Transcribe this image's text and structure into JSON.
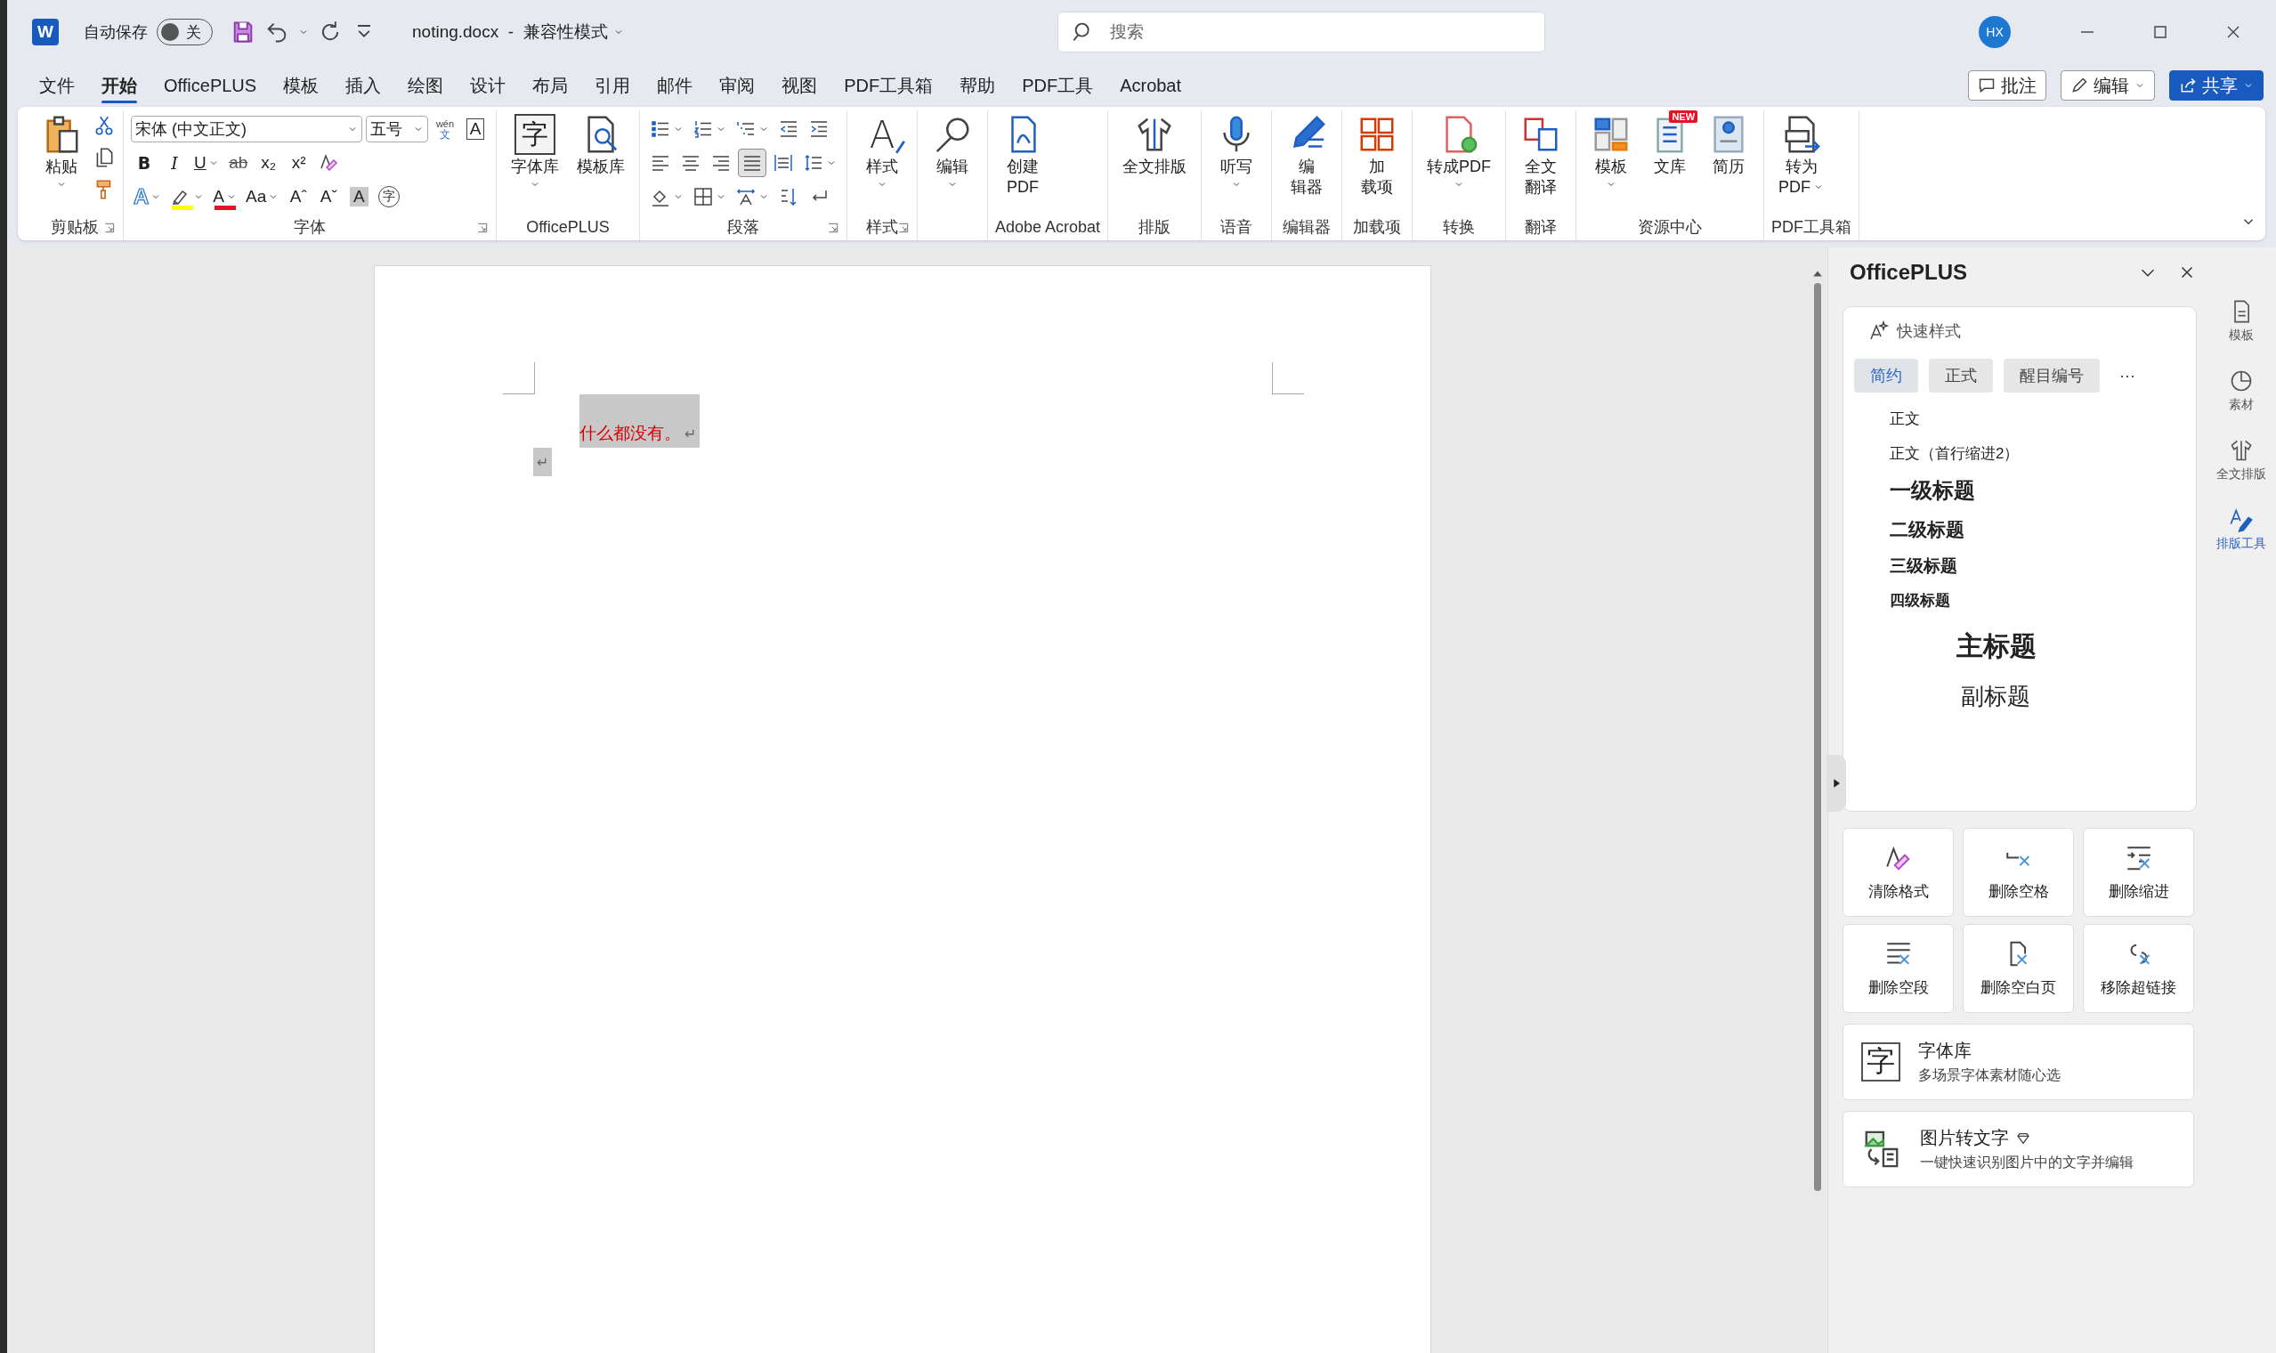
{
  "title_bar": {
    "app_glyph": "W",
    "autosave_label": "自动保存",
    "autosave": {
      "on": false,
      "label": "关"
    },
    "document_title": "noting.docx  -  兼容性模式",
    "search_placeholder": "搜索",
    "avatar": "HX"
  },
  "menu_tabs": [
    {
      "label": "文件",
      "selected": false
    },
    {
      "label": "开始",
      "selected": true
    },
    {
      "label": "OfficePLUS",
      "selected": false
    },
    {
      "label": "模板",
      "selected": false
    },
    {
      "label": "插入",
      "selected": false
    },
    {
      "label": "绘图",
      "selected": false
    },
    {
      "label": "设计",
      "selected": false
    },
    {
      "label": "布局",
      "selected": false
    },
    {
      "label": "引用",
      "selected": false
    },
    {
      "label": "邮件",
      "selected": false
    },
    {
      "label": "审阅",
      "selected": false
    },
    {
      "label": "视图",
      "selected": false
    },
    {
      "label": "PDF工具箱",
      "selected": false
    },
    {
      "label": "帮助",
      "selected": false
    },
    {
      "label": "PDF工具",
      "selected": false
    },
    {
      "label": "Acrobat",
      "selected": false
    }
  ],
  "top_buttons": [
    {
      "kind": "comment",
      "label": "批注"
    },
    {
      "kind": "edit",
      "label": "编辑"
    },
    {
      "kind": "share",
      "label": "共享"
    }
  ],
  "ribbon": {
    "groups": [
      {
        "kind": "clipboard",
        "label": "剪贴板",
        "launcher": true,
        "buttons": [
          {
            "kind": "paste",
            "lines": [
              "粘贴"
            ],
            "dropdown": true
          }
        ],
        "small": [
          {
            "kind": "cut"
          },
          {
            "kind": "copy"
          },
          {
            "kind": "format_painter"
          }
        ]
      },
      {
        "kind": "font",
        "label": "字体",
        "launcher": true,
        "font_name": "宋体 (中文正文)",
        "font_size": "五号",
        "rows": [
          {
            "tools": [
              {
                "kind": "phonetic",
                "lines": [
                  "wén",
                  "文"
                ]
              },
              {
                "kind": "enclose_border",
                "text": "A"
              }
            ]
          },
          {
            "tools": [
              {
                "kind": "bold",
                "text": "B"
              },
              {
                "kind": "italic",
                "text": "I"
              },
              {
                "kind": "underline",
                "text": "U",
                "dropdown": true
              },
              {
                "kind": "strike",
                "text": "ab"
              },
              {
                "kind": "subscript",
                "text": "x₂"
              },
              {
                "kind": "superscript",
                "text": "x²"
              },
              {
                "kind": "clear_format"
              }
            ]
          },
          {
            "tools": [
              {
                "kind": "text_effect",
                "text": "A",
                "dropdown": true
              },
              {
                "kind": "highlight",
                "dropdown": true,
                "color": "#ffff00"
              },
              {
                "kind": "font_color",
                "text": "A",
                "dropdown": true,
                "color": "#e81123"
              },
              {
                "kind": "change_case",
                "text": "Aa",
                "dropdown": true
              },
              {
                "kind": "grow",
                "text": "Aˆ"
              },
              {
                "kind": "shrink",
                "text": "Aˇ"
              },
              {
                "kind": "char_shading",
                "text": "A"
              },
              {
                "kind": "enclose_char",
                "text": "字"
              }
            ]
          }
        ]
      },
      {
        "kind": "large",
        "label": "OfficePLUS",
        "buttons": [
          {
            "kind": "font_library",
            "lines": [
              "字体库"
            ],
            "dropdown": true,
            "glyph": "字"
          },
          {
            "kind": "template_library",
            "lines": [
              "模板库"
            ]
          }
        ]
      },
      {
        "kind": "paragraph",
        "label": "段落",
        "launcher": true,
        "rows": [
          {
            "tools": [
              {
                "kind": "bullets",
                "dropdown": true
              },
              {
                "kind": "numbering",
                "dropdown": true
              },
              {
                "kind": "multilevel",
                "dropdown": true
              },
              {
                "kind": "decrease_indent"
              },
              {
                "kind": "increase_indent"
              }
            ]
          },
          {
            "tools": [
              {
                "kind": "align_left",
                "selected": false
              },
              {
                "kind": "align_center",
                "selected": false
              },
              {
                "kind": "align_right",
                "selected": false
              },
              {
                "kind": "justify",
                "selected": true
              },
              {
                "kind": "distributed",
                "selected": false
              },
              {
                "kind": "line_spacing",
                "dropdown": true
              }
            ]
          },
          {
            "tools": [
              {
                "kind": "shading",
                "dropdown": true
              },
              {
                "kind": "borders",
                "dropdown": true
              },
              {
                "kind": "asian_layout",
                "dropdown": true
              },
              {
                "kind": "sort"
              },
              {
                "kind": "show_marks"
              }
            ]
          }
        ]
      },
      {
        "kind": "large",
        "label": "样式",
        "launcher": true,
        "buttons": [
          {
            "kind": "styles",
            "lines": [
              "样式"
            ],
            "dropdown": true,
            "glyph": "A"
          }
        ]
      },
      {
        "kind": "large",
        "buttons": [
          {
            "kind": "find",
            "lines": [
              "编辑"
            ],
            "dropdown": true
          }
        ]
      },
      {
        "kind": "large",
        "label": "Adobe Acrobat",
        "buttons": [
          {
            "kind": "create_pdf",
            "lines": [
              "创建",
              "PDF"
            ]
          }
        ]
      },
      {
        "kind": "large",
        "label": "排版",
        "buttons": [
          {
            "kind": "layout",
            "lines": [
              "全文排版"
            ]
          }
        ]
      },
      {
        "kind": "large",
        "label": "语音",
        "buttons": [
          {
            "kind": "dictate",
            "lines": [
              "听写"
            ],
            "dropdown": true
          }
        ]
      },
      {
        "kind": "large",
        "label": "编辑器",
        "buttons": [
          {
            "kind": "editor",
            "lines": [
              "编",
              "辑器"
            ]
          }
        ]
      },
      {
        "kind": "large",
        "label": "加载项",
        "buttons": [
          {
            "kind": "addins",
            "lines": [
              "加",
              "载项"
            ]
          }
        ]
      },
      {
        "kind": "large",
        "label": "转换",
        "buttons": [
          {
            "kind": "to_pdf",
            "lines": [
              "转成PDF"
            ],
            "dropdown": true
          }
        ]
      },
      {
        "kind": "large",
        "label": "翻译",
        "buttons": [
          {
            "kind": "translate",
            "lines": [
              "全文",
              "翻译"
            ]
          }
        ]
      },
      {
        "kind": "large",
        "label": "资源中心",
        "buttons": [
          {
            "kind": "templates",
            "lines": [
              "模板"
            ],
            "dropdown": true
          },
          {
            "kind": "library",
            "lines": [
              "文库"
            ],
            "badge": "NEW"
          },
          {
            "kind": "resume",
            "lines": [
              "简历"
            ]
          }
        ]
      },
      {
        "kind": "large",
        "label": "PDF工具箱",
        "buttons": [
          {
            "kind": "convert_pdf",
            "lines": [
              "转为",
              "PDF"
            ],
            "dropdown": true
          }
        ]
      }
    ]
  },
  "document": {
    "paragraphs": [
      {
        "text": "什么都没有。",
        "mark": "↵",
        "selected": true
      },
      {
        "mark": "↵",
        "selected": true
      }
    ]
  },
  "side_panel": {
    "title": "OfficePLUS",
    "quick_styles": {
      "title": "快速样式",
      "tabs": [
        {
          "label": "简约",
          "selected": true
        },
        {
          "label": "正式",
          "selected": false
        },
        {
          "label": "醒目编号",
          "selected": false
        }
      ],
      "more": "···",
      "styles": [
        {
          "kind": "body",
          "text": "正文"
        },
        {
          "kind": "body",
          "text": "正文（首行缩进2）"
        },
        {
          "kind": "h1",
          "text": "一级标题"
        },
        {
          "kind": "h2",
          "text": "二级标题"
        },
        {
          "kind": "h3",
          "text": "三级标题"
        },
        {
          "kind": "h4",
          "text": "四级标题"
        },
        {
          "kind": "title",
          "text": "主标题"
        },
        {
          "kind": "subtitle",
          "text": "副标题"
        }
      ]
    },
    "tools": [
      {
        "kind": "clear_format",
        "label": "清除格式"
      },
      {
        "kind": "delete_spaces",
        "label": "删除空格"
      },
      {
        "kind": "delete_indent",
        "label": "删除缩进"
      },
      {
        "kind": "delete_empty_paragraphs",
        "label": "删除空段"
      },
      {
        "kind": "delete_blank_pages",
        "label": "删除空白页"
      },
      {
        "kind": "remove_links",
        "label": "移除超链接"
      }
    ],
    "cards": [
      {
        "kind": "font_library",
        "title": "字体库",
        "subtitle": "多场景字体素材随心选",
        "glyph": "字",
        "premium": false
      },
      {
        "kind": "image_to_text",
        "title": "图片转文字",
        "subtitle": "一键快速识别图片中的文字并编辑",
        "premium": true
      }
    ]
  },
  "rail": [
    {
      "kind": "template",
      "label": "模板",
      "selected": false
    },
    {
      "kind": "material",
      "label": "素材",
      "selected": false
    },
    {
      "kind": "layout",
      "label": "全文排版",
      "selected": false
    },
    {
      "kind": "format_tool",
      "label": "排版工具",
      "selected": true
    }
  ]
}
